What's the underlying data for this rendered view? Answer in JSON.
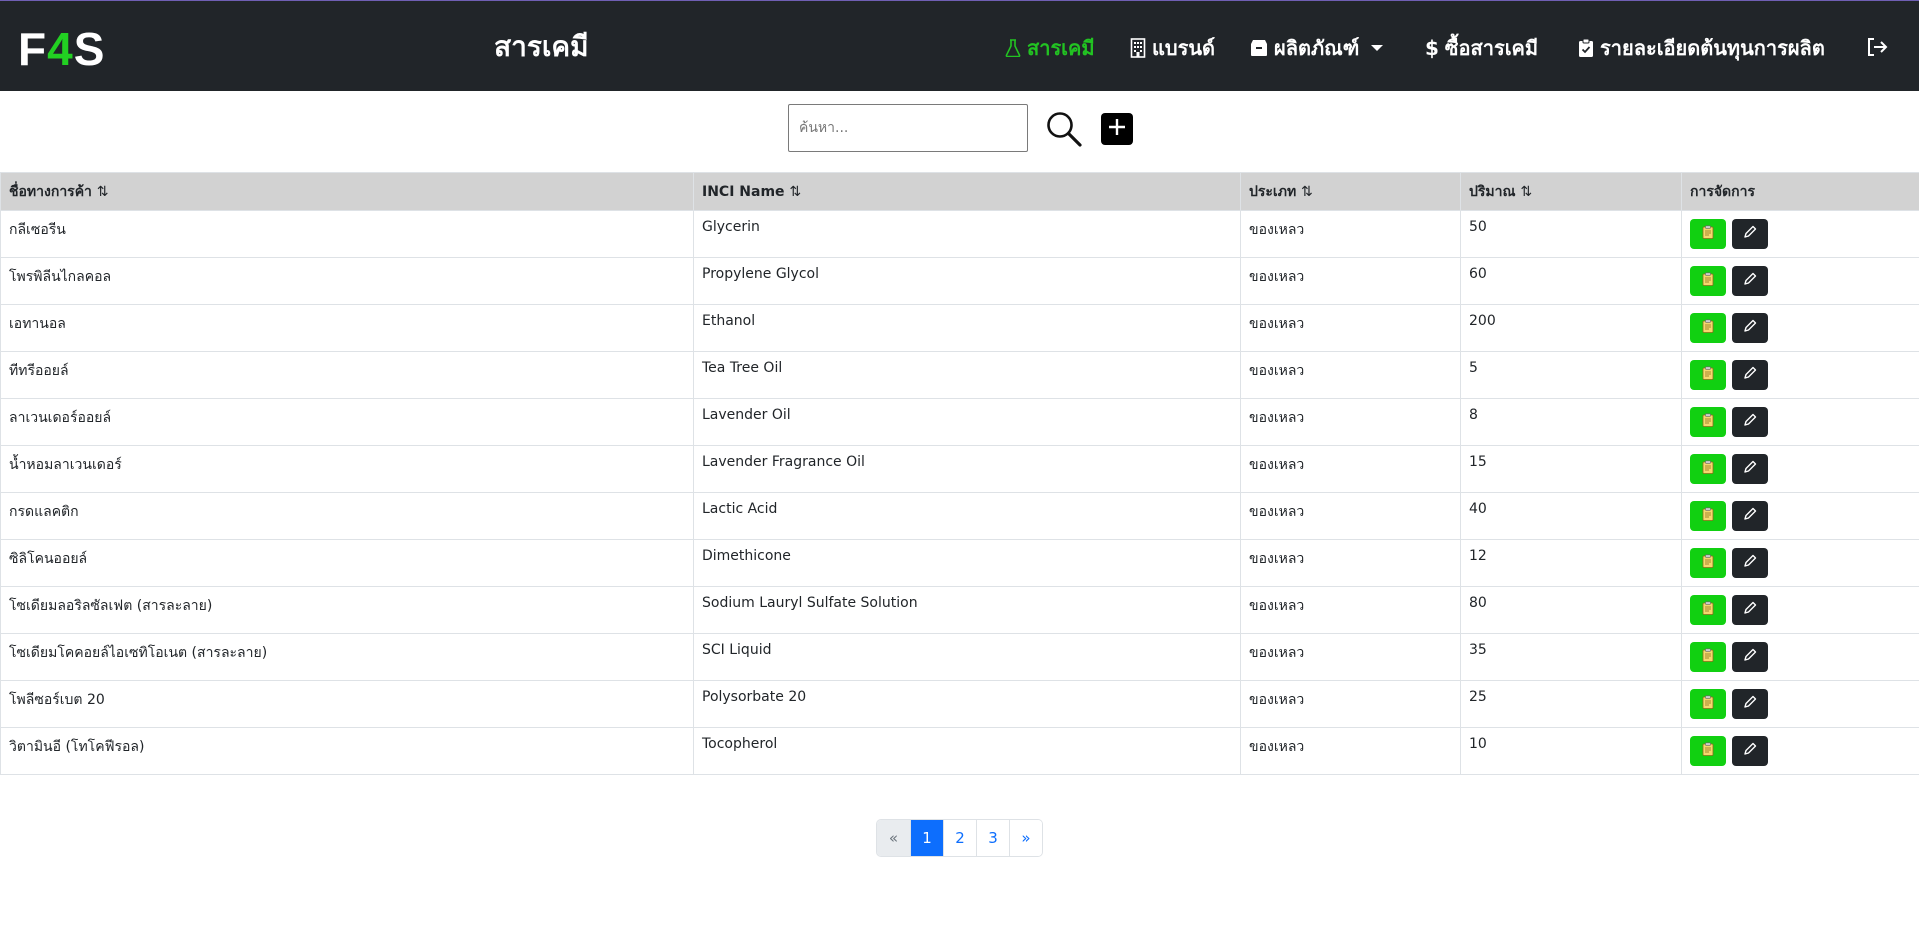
{
  "app": {
    "logo_prefix": "F",
    "logo_accent": "4",
    "logo_suffix": "S",
    "page_title": "สารเคมี"
  },
  "nav": {
    "items": [
      {
        "label": "สารเคมี",
        "icon": "flask-icon",
        "active": true
      },
      {
        "label": "แบรนด์",
        "icon": "building-icon"
      },
      {
        "label": "ผลิตภัณฑ์",
        "icon": "box-icon",
        "dropdown": true
      },
      {
        "label": "ซื้อสารเคมี",
        "icon": "dollar-icon"
      },
      {
        "label": "รายละเอียดต้นทุนการผลิต",
        "icon": "clipboard-check-icon"
      }
    ],
    "logout_icon": "logout-icon"
  },
  "search": {
    "placeholder": "ค้นหา..."
  },
  "table": {
    "headers": [
      "ชื่อทางการค้า",
      "INCI Name",
      "ประเภท",
      "ปริมาณ",
      "การจัดการ"
    ],
    "rows": [
      {
        "trade_name": "กลีเซอรีน",
        "inci": "Glycerin",
        "type": "ของเหลว",
        "qty": "50"
      },
      {
        "trade_name": "โพรพิลีนไกลคอล",
        "inci": "Propylene Glycol",
        "type": "ของเหลว",
        "qty": "60"
      },
      {
        "trade_name": "เอทานอล",
        "inci": "Ethanol",
        "type": "ของเหลว",
        "qty": "200"
      },
      {
        "trade_name": "ทีทรีออยล์",
        "inci": "Tea Tree Oil",
        "type": "ของเหลว",
        "qty": "5"
      },
      {
        "trade_name": "ลาเวนเดอร์ออยล์",
        "inci": "Lavender Oil",
        "type": "ของเหลว",
        "qty": "8"
      },
      {
        "trade_name": "น้ำหอมลาเวนเดอร์",
        "inci": "Lavender Fragrance Oil",
        "type": "ของเหลว",
        "qty": "15"
      },
      {
        "trade_name": "กรดแลคติก",
        "inci": "Lactic Acid",
        "type": "ของเหลว",
        "qty": "40"
      },
      {
        "trade_name": "ซิลิโคนออยล์",
        "inci": "Dimethicone",
        "type": "ของเหลว",
        "qty": "12"
      },
      {
        "trade_name": "โซเดียมลอริลซัลเฟต (สารละลาย)",
        "inci": "Sodium Lauryl Sulfate Solution",
        "type": "ของเหลว",
        "qty": "80"
      },
      {
        "trade_name": "โซเดียมโคคอยล์ไอเซทิโอเนต (สารละลาย)",
        "inci": "SCI Liquid",
        "type": "ของเหลว",
        "qty": "35"
      },
      {
        "trade_name": "โพลีซอร์เบต 20",
        "inci": "Polysorbate 20",
        "type": "ของเหลว",
        "qty": "25"
      },
      {
        "trade_name": "วิตามินอี (โทโคฟีรอล)",
        "inci": "Tocopherol",
        "type": "ของเหลว",
        "qty": "10"
      }
    ]
  },
  "pagination": {
    "prev": "«",
    "pages": [
      "1",
      "2",
      "3"
    ],
    "next": "»",
    "current": "1"
  },
  "colors": {
    "navbar": "#212529",
    "accent_green": "#11d011",
    "primary": "#0d6efd",
    "header_bg": "#d2d2d2"
  }
}
